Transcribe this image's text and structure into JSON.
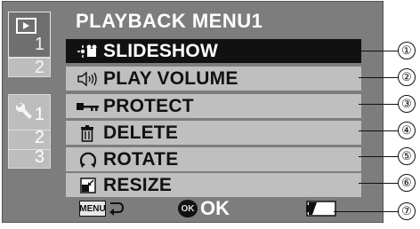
{
  "title": "PLAYBACK MENU1",
  "tabs": {
    "playback_page1": "1",
    "playback_page2": "2",
    "setup_page1": "1",
    "setup_page2": "2",
    "setup_page3": "3"
  },
  "menu_items": [
    {
      "label": "SLIDESHOW",
      "icon": "slideshow-icon",
      "selected": true
    },
    {
      "label": "PLAY VOLUME",
      "icon": "speaker-icon",
      "selected": false
    },
    {
      "label": "PROTECT",
      "icon": "key-icon",
      "selected": false
    },
    {
      "label": "DELETE",
      "icon": "trash-icon",
      "selected": false
    },
    {
      "label": "ROTATE",
      "icon": "rotate-icon",
      "selected": false
    },
    {
      "label": "RESIZE",
      "icon": "resize-icon",
      "selected": false
    }
  ],
  "footer": {
    "menu_button": "MENU",
    "ok_button": "OK",
    "ok_label": "OK"
  },
  "callouts": [
    "①",
    "②",
    "③",
    "④",
    "⑤",
    "⑥",
    "⑦"
  ]
}
